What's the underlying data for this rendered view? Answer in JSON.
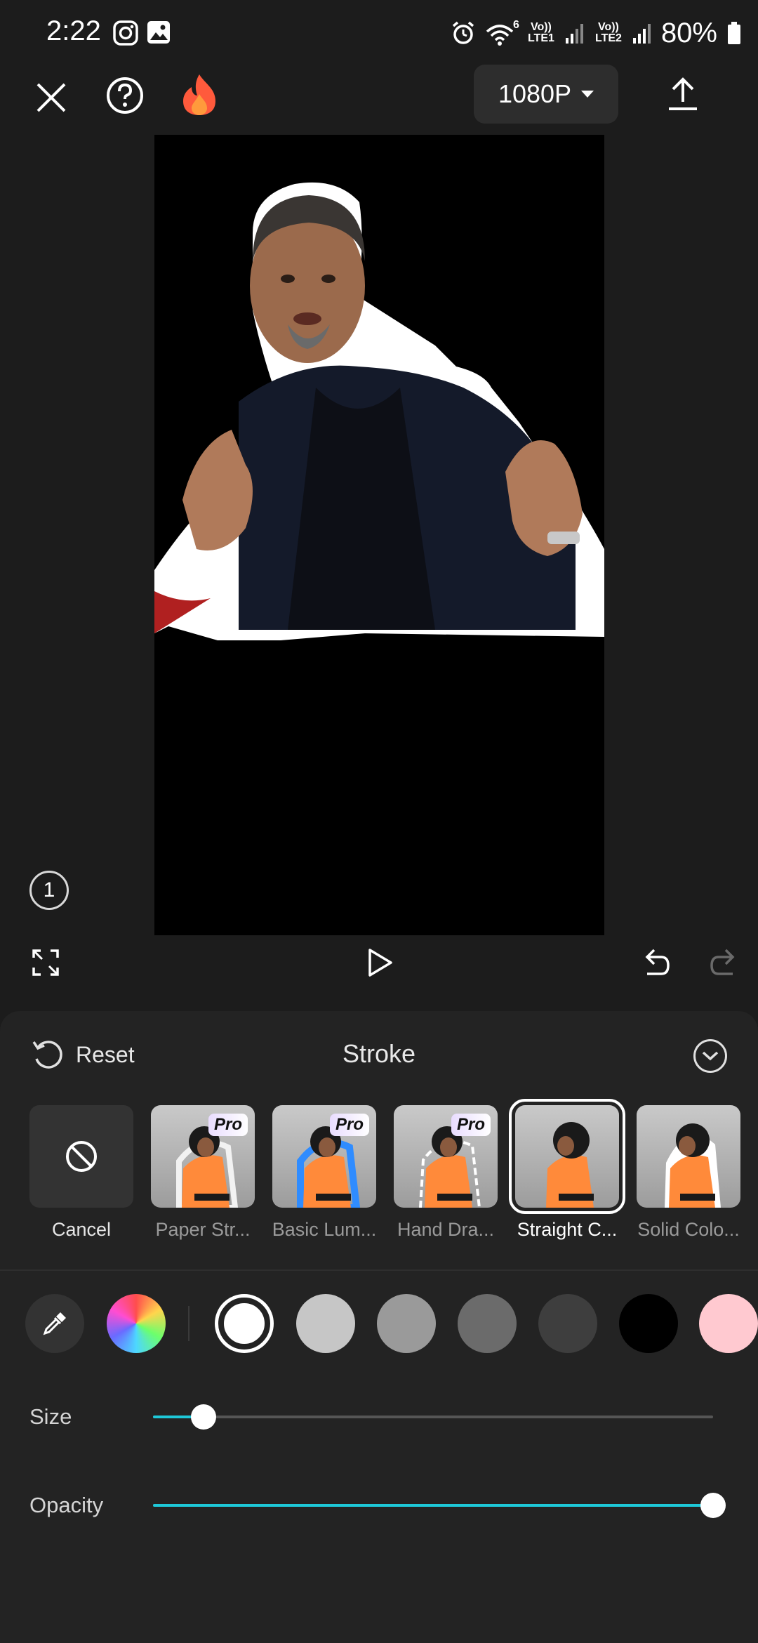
{
  "status_bar": {
    "time": "2:22",
    "battery": "80%",
    "sim1": "Vo)) LTE1",
    "sim2": "Vo)) LTE2",
    "wifi_badge": "6",
    "icons": [
      "instagram-icon",
      "gallery-icon",
      "alarm-icon",
      "wifi-icon",
      "signal-icon",
      "battery-icon"
    ]
  },
  "toolbar": {
    "resolution": "1080P",
    "icons": [
      "close-icon",
      "help-icon",
      "flame-icon",
      "export-icon"
    ]
  },
  "preview": {
    "page_number": "1",
    "controls": [
      "fullscreen-icon",
      "play-icon",
      "undo-icon",
      "redo-icon"
    ]
  },
  "panel": {
    "reset_label": "Reset",
    "title": "Stroke",
    "presets": [
      {
        "label": "Cancel",
        "pro": false,
        "selected": false
      },
      {
        "label": "Paper Str...",
        "pro": true,
        "selected": false
      },
      {
        "label": "Basic Lum...",
        "pro": true,
        "selected": false
      },
      {
        "label": "Hand Dra...",
        "pro": true,
        "selected": false
      },
      {
        "label": "Straight C...",
        "pro": false,
        "selected": true
      },
      {
        "label": "Solid Colo...",
        "pro": false,
        "selected": false
      }
    ],
    "pro_badge": "Pro",
    "colors": {
      "selected": "#ffffff",
      "swatches": [
        "#ffffff",
        "#c6c6c6",
        "#9a9a9a",
        "#6b6b6b",
        "#3e3e3e",
        "#000000",
        "#ffc9d0"
      ]
    },
    "size": {
      "label": "Size",
      "value": 0.09
    },
    "opacity": {
      "label": "Opacity",
      "value": 1.0
    },
    "accent": "#1ec8d8"
  }
}
